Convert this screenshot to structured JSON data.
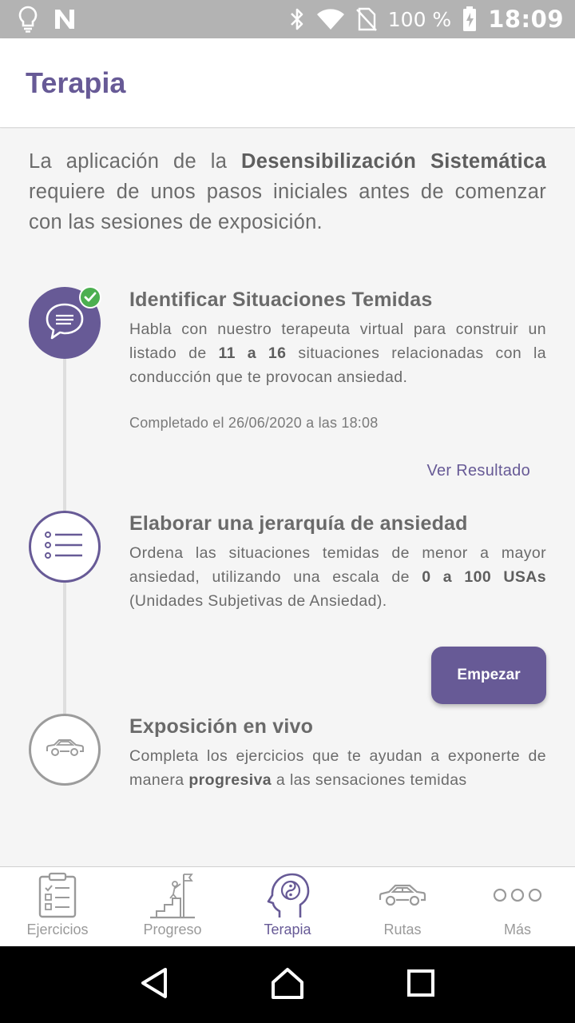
{
  "status_bar": {
    "battery": "100 %",
    "time": "18:09",
    "icons": [
      "lightbulb-icon",
      "n-app-icon",
      "bluetooth-icon",
      "wifi-icon",
      "no-sim-icon",
      "battery-icon"
    ]
  },
  "app_bar": {
    "title": "Terapia"
  },
  "intro": {
    "pre": "La aplicación de la ",
    "bold": "Desensibilización Sistemática",
    "post": " requiere de unos pasos iniciales antes de comenzar con las sesiones de exposición."
  },
  "steps": [
    {
      "icon": "chat-bubble-icon",
      "completed": true,
      "title": "Identificar Situaciones Temidas",
      "desc_pre": "Habla con nuestro terapeuta virtual para construir un listado de ",
      "desc_bold": "11 a 16",
      "desc_post": " situaciones relacionadas con la conducción que te provocan ansiedad.",
      "completed_text": "Completado el 26/06/2020 a las 18:08",
      "action": "Ver Resultado"
    },
    {
      "icon": "list-icon",
      "completed": false,
      "title": "Elaborar una jerarquía de ansiedad",
      "desc_pre": "Ordena las situaciones temidas de menor a mayor ansiedad, utilizando una escala de ",
      "desc_bold": "0 a 100 USAs",
      "desc_post": " (Unidades Subjetivas de Ansiedad).",
      "action": "Empezar"
    },
    {
      "icon": "car-icon",
      "completed": false,
      "title": "Exposición en vivo",
      "desc_pre": "Completa los ejercicios que te ayudan a exponerte de manera ",
      "desc_bold": "progresiva",
      "desc_post": " a las sensaciones temidas"
    }
  ],
  "bottom_nav": {
    "active": "Terapia",
    "items": [
      {
        "label": "Ejercicios",
        "icon": "clipboard-icon"
      },
      {
        "label": "Progreso",
        "icon": "summit-icon"
      },
      {
        "label": "Terapia",
        "icon": "head-yin-yang-icon"
      },
      {
        "label": "Rutas",
        "icon": "car-icon"
      },
      {
        "label": "Más",
        "icon": "more-icon"
      }
    ]
  },
  "colors": {
    "accent": "#675a96",
    "success": "#4caf50",
    "text": "#6b6b6b",
    "status_bar": "#b3b3b3"
  }
}
